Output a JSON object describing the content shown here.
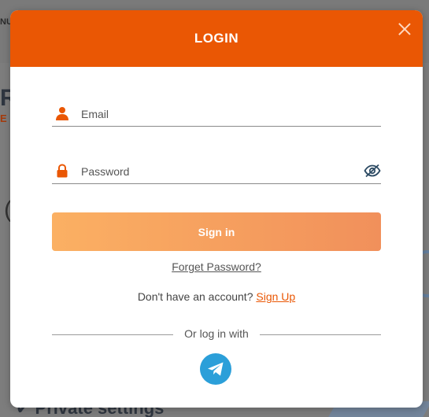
{
  "background": {
    "nav_fragment": "NU",
    "heading_fragment": "RT",
    "subheading_fragment": "E I",
    "paren_fragment": "(",
    "private_settings": "Private settings"
  },
  "modal": {
    "title": "LOGIN",
    "close_icon": "close-icon",
    "email": {
      "placeholder": "Email",
      "value": "",
      "icon": "user-icon"
    },
    "password": {
      "placeholder": "Password",
      "value": "",
      "icon": "lock-icon",
      "toggle_icon": "eye-off-icon"
    },
    "signin_label": "Sign in",
    "forget_password": "Forget Password?",
    "no_account_text": "Don't have an account?",
    "signup_label": "Sign Up",
    "or_log_in_with": "Or log in with",
    "social": [
      {
        "name": "telegram",
        "icon": "telegram-icon"
      }
    ]
  },
  "colors": {
    "brand_orange": "#ea5704",
    "button_gradient_start": "#fbb063",
    "button_gradient_end": "#f1905b",
    "telegram_blue": "#2b9fd9"
  }
}
